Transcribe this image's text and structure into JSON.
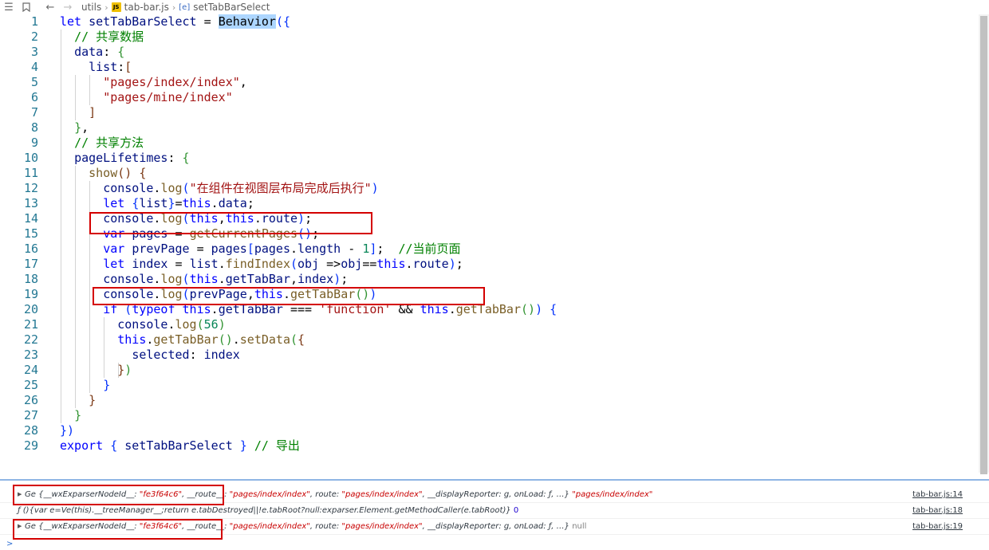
{
  "breadcrumb": {
    "menu_icon": "list-icon",
    "bookmark_icon": "bookmark-icon",
    "back_icon": "arrow-left-icon",
    "forward_icon": "arrow-right-icon",
    "folder": "utils",
    "file": "tab-bar.js",
    "file_badge": "JS",
    "symbol_badge": "[e]",
    "symbol": "setTabBarSelect"
  },
  "editor": {
    "lines": [
      [
        [
          "kw",
          "let"
        ],
        [
          "pn",
          " "
        ],
        [
          "vr",
          "setTabBarSelect"
        ],
        [
          "pn",
          " = "
        ],
        [
          "hl",
          "Behavior"
        ],
        [
          "b1",
          "({"
        ]
      ],
      [
        [
          "pn",
          "  "
        ],
        [
          "cm",
          "// 共享数据"
        ]
      ],
      [
        [
          "pn",
          "  "
        ],
        [
          "vr",
          "data"
        ],
        [
          "pn",
          ": "
        ],
        [
          "b2",
          "{"
        ]
      ],
      [
        [
          "pn",
          "    "
        ],
        [
          "vr",
          "list"
        ],
        [
          "pn",
          ":"
        ],
        [
          "b3",
          "["
        ]
      ],
      [
        [
          "pn",
          "      "
        ],
        [
          "str",
          "\"pages/index/index\""
        ],
        [
          "pn",
          ","
        ]
      ],
      [
        [
          "pn",
          "      "
        ],
        [
          "str",
          "\"pages/mine/index\""
        ]
      ],
      [
        [
          "pn",
          "    "
        ],
        [
          "b3",
          "]"
        ]
      ],
      [
        [
          "pn",
          "  "
        ],
        [
          "b2",
          "}"
        ],
        [
          "pn",
          ","
        ]
      ],
      [
        [
          "pn",
          "  "
        ],
        [
          "cm",
          "// 共享方法"
        ]
      ],
      [
        [
          "pn",
          "  "
        ],
        [
          "vr",
          "pageLifetimes"
        ],
        [
          "pn",
          ": "
        ],
        [
          "b2",
          "{"
        ]
      ],
      [
        [
          "pn",
          "    "
        ],
        [
          "fn",
          "show"
        ],
        [
          "b3",
          "()"
        ],
        [
          "pn",
          " "
        ],
        [
          "b3",
          "{"
        ]
      ],
      [
        [
          "pn",
          "      "
        ],
        [
          "vr",
          "console"
        ],
        [
          "pn",
          "."
        ],
        [
          "fn",
          "log"
        ],
        [
          "b1",
          "("
        ],
        [
          "str",
          "\"在组件在视图层布局完成后执行\""
        ],
        [
          "b1",
          ")"
        ]
      ],
      [
        [
          "pn",
          "      "
        ],
        [
          "kw",
          "let"
        ],
        [
          "pn",
          " "
        ],
        [
          "b1",
          "{"
        ],
        [
          "vr",
          "list"
        ],
        [
          "b1",
          "}"
        ],
        [
          "pn",
          "="
        ],
        [
          "th",
          "this"
        ],
        [
          "pn",
          "."
        ],
        [
          "vr",
          "data"
        ],
        [
          "pn",
          ";"
        ]
      ],
      [
        [
          "pn",
          "      "
        ],
        [
          "vr",
          "console"
        ],
        [
          "pn",
          "."
        ],
        [
          "fn",
          "log"
        ],
        [
          "b1",
          "("
        ],
        [
          "th",
          "this"
        ],
        [
          "pn",
          ","
        ],
        [
          "th",
          "this"
        ],
        [
          "pn",
          "."
        ],
        [
          "vr",
          "route"
        ],
        [
          "b1",
          ")"
        ],
        [
          "pn",
          ";"
        ]
      ],
      [
        [
          "pn",
          "      "
        ],
        [
          "kw",
          "var"
        ],
        [
          "pn",
          " "
        ],
        [
          "vr",
          "pages"
        ],
        [
          "pn",
          " = "
        ],
        [
          "fn",
          "getCurrentPages"
        ],
        [
          "b1",
          "()"
        ],
        [
          "pn",
          ";"
        ]
      ],
      [
        [
          "pn",
          "      "
        ],
        [
          "kw",
          "var"
        ],
        [
          "pn",
          " "
        ],
        [
          "vr",
          "prevPage"
        ],
        [
          "pn",
          " = "
        ],
        [
          "vr",
          "pages"
        ],
        [
          "b1",
          "["
        ],
        [
          "vr",
          "pages"
        ],
        [
          "pn",
          "."
        ],
        [
          "vr",
          "length"
        ],
        [
          "pn",
          " - "
        ],
        [
          "num",
          "1"
        ],
        [
          "b1",
          "]"
        ],
        [
          "pn",
          ";  "
        ],
        [
          "cm",
          "//当前页面"
        ]
      ],
      [
        [
          "pn",
          "      "
        ],
        [
          "kw",
          "let"
        ],
        [
          "pn",
          " "
        ],
        [
          "vr",
          "index"
        ],
        [
          "pn",
          " = "
        ],
        [
          "vr",
          "list"
        ],
        [
          "pn",
          "."
        ],
        [
          "fn",
          "findIndex"
        ],
        [
          "b1",
          "("
        ],
        [
          "vr",
          "obj"
        ],
        [
          "pn",
          " =>"
        ],
        [
          "vr",
          "obj"
        ],
        [
          "pn",
          "=="
        ],
        [
          "th",
          "this"
        ],
        [
          "pn",
          "."
        ],
        [
          "vr",
          "route"
        ],
        [
          "b1",
          ")"
        ],
        [
          "pn",
          ";"
        ]
      ],
      [
        [
          "pn",
          "      "
        ],
        [
          "vr",
          "console"
        ],
        [
          "pn",
          "."
        ],
        [
          "fn",
          "log"
        ],
        [
          "b1",
          "("
        ],
        [
          "th",
          "this"
        ],
        [
          "pn",
          "."
        ],
        [
          "vr",
          "getTabBar"
        ],
        [
          "pn",
          ","
        ],
        [
          "vr",
          "index"
        ],
        [
          "b1",
          ")"
        ],
        [
          "pn",
          ";"
        ]
      ],
      [
        [
          "pn",
          "      "
        ],
        [
          "vr",
          "console"
        ],
        [
          "pn",
          "."
        ],
        [
          "fn",
          "log"
        ],
        [
          "b1",
          "("
        ],
        [
          "vr",
          "prevPage"
        ],
        [
          "pn",
          ","
        ],
        [
          "th",
          "this"
        ],
        [
          "pn",
          "."
        ],
        [
          "fn",
          "getTabBar"
        ],
        [
          "b2",
          "()"
        ],
        [
          "b1",
          ")"
        ]
      ],
      [
        [
          "pn",
          "      "
        ],
        [
          "kw",
          "if"
        ],
        [
          "pn",
          " "
        ],
        [
          "b1",
          "("
        ],
        [
          "kw",
          "typeof"
        ],
        [
          "pn",
          " "
        ],
        [
          "th",
          "this"
        ],
        [
          "pn",
          "."
        ],
        [
          "vr",
          "getTabBar"
        ],
        [
          "pn",
          " === "
        ],
        [
          "str",
          "'function'"
        ],
        [
          "pn",
          " && "
        ],
        [
          "th",
          "this"
        ],
        [
          "pn",
          "."
        ],
        [
          "fn",
          "getTabBar"
        ],
        [
          "b2",
          "()"
        ],
        [
          "b1",
          ")"
        ],
        [
          "pn",
          " "
        ],
        [
          "b1",
          "{"
        ]
      ],
      [
        [
          "pn",
          "        "
        ],
        [
          "vr",
          "console"
        ],
        [
          "pn",
          "."
        ],
        [
          "fn",
          "log"
        ],
        [
          "b2",
          "("
        ],
        [
          "num",
          "56"
        ],
        [
          "b2",
          ")"
        ]
      ],
      [
        [
          "pn",
          "        "
        ],
        [
          "th",
          "this"
        ],
        [
          "pn",
          "."
        ],
        [
          "fn",
          "getTabBar"
        ],
        [
          "b2",
          "()"
        ],
        [
          "pn",
          "."
        ],
        [
          "fn",
          "setData"
        ],
        [
          "b2",
          "("
        ],
        [
          "b3",
          "{"
        ]
      ],
      [
        [
          "pn",
          "          "
        ],
        [
          "vr",
          "selected"
        ],
        [
          "pn",
          ": "
        ],
        [
          "vr",
          "index"
        ]
      ],
      [
        [
          "pn",
          "        "
        ],
        [
          "b3",
          "}"
        ],
        [
          "b2",
          ")"
        ]
      ],
      [
        [
          "pn",
          "      "
        ],
        [
          "b1",
          "}"
        ]
      ],
      [
        [
          "pn",
          "    "
        ],
        [
          "b3",
          "}"
        ]
      ],
      [
        [
          "pn",
          "  "
        ],
        [
          "b2",
          "}"
        ]
      ],
      [
        [
          "b1",
          "})"
        ]
      ],
      [
        [
          "kw",
          "export"
        ],
        [
          "pn",
          " "
        ],
        [
          "b1",
          "{"
        ],
        [
          "pn",
          " "
        ],
        [
          "vr",
          "setTabBarSelect"
        ],
        [
          "pn",
          " "
        ],
        [
          "b1",
          "}"
        ],
        [
          "pn",
          " "
        ],
        [
          "cm",
          "// 导出"
        ]
      ]
    ]
  },
  "console": {
    "rows": [
      {
        "expandable": true,
        "segments": [
          [
            "key",
            "Ge {__wxExparserNodeId__: "
          ],
          [
            "sv",
            "\"fe3f64c6\""
          ],
          [
            "key",
            ", __route__: "
          ],
          [
            "sv",
            "\"pages/index/index\""
          ],
          [
            "key",
            ", route: "
          ],
          [
            "sv",
            "\"pages/index/index\""
          ],
          [
            "key",
            ", __displayReporter: g, onLoad: ƒ, …} "
          ],
          [
            "sv",
            "\"pages/index/index\""
          ]
        ],
        "source": "tab-bar.js:14"
      },
      {
        "expandable": false,
        "segments": [
          [
            "key",
            "ƒ (){var e=Ve(this).__treeManager__;return e.tabDestroyed||!e.tabRoot?null:exparser.Element.getMethodCaller(e.tabRoot)} "
          ],
          [
            "num2",
            "0"
          ]
        ],
        "source": "tab-bar.js:18"
      },
      {
        "expandable": true,
        "segments": [
          [
            "key",
            "Ge {__wxExparserNodeId__: "
          ],
          [
            "sv",
            "\"fe3f64c6\""
          ],
          [
            "key",
            ", __route__: "
          ],
          [
            "sv",
            "\"pages/index/index\""
          ],
          [
            "key",
            ", route: "
          ],
          [
            "sv",
            "\"pages/index/index\""
          ],
          [
            "key",
            ", __displayReporter: g, onLoad: ƒ, …} "
          ],
          [
            "nl",
            "null"
          ]
        ],
        "source": "tab-bar.js:19"
      }
    ],
    "prompt": ">"
  }
}
